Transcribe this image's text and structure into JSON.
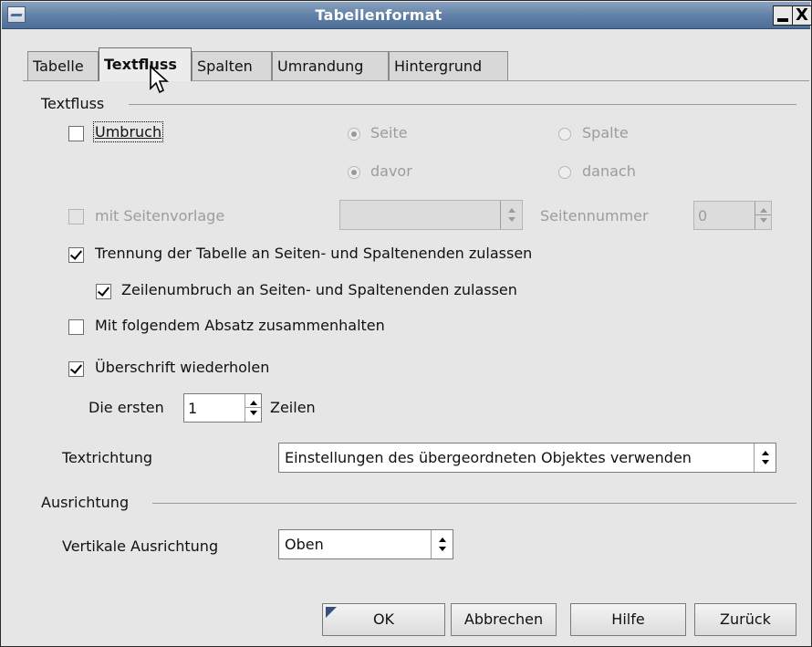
{
  "window": {
    "title": "Tabellenformat",
    "minimize_label": "",
    "close_label": "X"
  },
  "tabs": [
    {
      "label": "Tabelle",
      "active": false
    },
    {
      "label": "Textfluss",
      "active": true
    },
    {
      "label": "Spalten",
      "active": false
    },
    {
      "label": "Umrandung",
      "active": false
    },
    {
      "label": "Hintergrund",
      "active": false
    }
  ],
  "textfluss": {
    "group_label": "Textfluss",
    "umbruch": {
      "label": "Umbruch",
      "checked": false
    },
    "seite": {
      "label": "Seite",
      "selected": true
    },
    "spalte": {
      "label": "Spalte",
      "selected": false
    },
    "davor": {
      "label": "davor",
      "selected": true
    },
    "danach": {
      "label": "danach",
      "selected": false
    },
    "mit_seitenvorlage": {
      "label": "mit Seitenvorlage",
      "checked": false
    },
    "seitenvorlage_value": "",
    "seitennummer_label": "Seitennummer",
    "seitennummer_value": "0",
    "trennung": {
      "label": "Trennung der Tabelle an Seiten- und Spaltenenden zulassen",
      "checked": true
    },
    "zeilenumbruch": {
      "label": "Zeilenumbruch an Seiten- und Spaltenenden zulassen",
      "checked": true
    },
    "zusammenhalten": {
      "label": "Mit folgendem Absatz zusammenhalten",
      "checked": false
    },
    "ueberschrift": {
      "label": "Überschrift wiederholen",
      "checked": true
    },
    "die_ersten_label": "Die ersten",
    "die_ersten_value": "1",
    "zeilen_label": "Zeilen",
    "textrichtung_label": "Textrichtung",
    "textrichtung_value": "Einstellungen des übergeordneten Objektes verwenden"
  },
  "ausrichtung": {
    "group_label": "Ausrichtung",
    "vertikal_label": "Vertikale Ausrichtung",
    "vertikal_value": "Oben"
  },
  "buttons": {
    "ok": "OK",
    "abbrechen": "Abbrechen",
    "hilfe": "Hilfe",
    "zurueck": "Zurück"
  },
  "colors": {
    "titlebar": "#5f7fa6",
    "dialog_bg": "#e6e6e6"
  }
}
